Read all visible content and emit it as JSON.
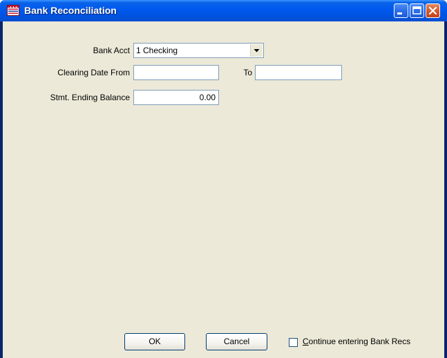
{
  "window": {
    "title": "Bank Reconciliation",
    "icons": {
      "app": "bank-reconciliation-app-icon",
      "minimize": "minimize-icon",
      "maximize": "maximize-icon",
      "close": "close-icon"
    }
  },
  "form": {
    "bank_acct_label": "Bank Acct",
    "bank_acct_value": "1 Checking",
    "clearing_date_from_label": "Clearing Date From",
    "clearing_date_from_value": "",
    "to_label": "To",
    "to_value": "",
    "stmt_ending_balance_label": "Stmt. Ending Balance",
    "stmt_ending_balance_value": "0.00"
  },
  "footer": {
    "ok_label": "OK",
    "cancel_label": "Cancel",
    "continue_checkbox_first_letter": "C",
    "continue_checkbox_rest": "ontinue entering Bank Recs",
    "continue_checked": false
  }
}
